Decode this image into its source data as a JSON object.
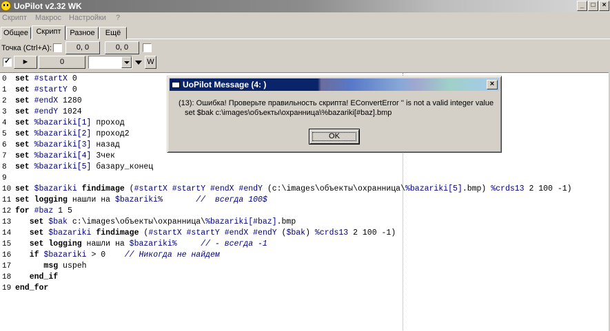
{
  "window": {
    "title": "UoPilot  v2.32   WK",
    "minimize": "_",
    "maximize": "□",
    "close": "×"
  },
  "menu": [
    "Скрипт",
    "Макрос",
    "Настройки",
    "?"
  ],
  "tabs": [
    "Общее",
    "Скрипт",
    "Разное",
    "Ещё"
  ],
  "toolbar": {
    "point_label": "Точка (Ctrl+A):",
    "coord1": "0, 0",
    "coord2": "0, 0",
    "play": "►",
    "counter": "0",
    "combo_value": "",
    "w_button": "W"
  },
  "editor": {
    "lines": [
      {
        "n": "0",
        "parts": [
          [
            "kw",
            "set"
          ],
          [
            "txt",
            " "
          ],
          [
            "var",
            "#startX"
          ],
          [
            "txt",
            " 0"
          ]
        ]
      },
      {
        "n": "1",
        "parts": [
          [
            "kw",
            "set"
          ],
          [
            "txt",
            " "
          ],
          [
            "var",
            "#startY"
          ],
          [
            "txt",
            " 0"
          ]
        ]
      },
      {
        "n": "2",
        "parts": [
          [
            "kw",
            "set"
          ],
          [
            "txt",
            " "
          ],
          [
            "var",
            "#endX"
          ],
          [
            "txt",
            " 1280"
          ]
        ]
      },
      {
        "n": "3",
        "parts": [
          [
            "kw",
            "set"
          ],
          [
            "txt",
            " "
          ],
          [
            "var",
            "#endY"
          ],
          [
            "txt",
            " 1024"
          ]
        ]
      },
      {
        "n": "4",
        "parts": [
          [
            "kw",
            "set"
          ],
          [
            "txt",
            " "
          ],
          [
            "var",
            "%bazariki[1]"
          ],
          [
            "txt",
            " проход"
          ]
        ]
      },
      {
        "n": "5",
        "parts": [
          [
            "kw",
            "set"
          ],
          [
            "txt",
            " "
          ],
          [
            "var",
            "%bazariki[2]"
          ],
          [
            "txt",
            " проход2"
          ]
        ]
      },
      {
        "n": "6",
        "parts": [
          [
            "kw",
            "set"
          ],
          [
            "txt",
            " "
          ],
          [
            "var",
            "%bazariki[3]"
          ],
          [
            "txt",
            " назад"
          ]
        ]
      },
      {
        "n": "7",
        "parts": [
          [
            "kw",
            "set"
          ],
          [
            "txt",
            " "
          ],
          [
            "var",
            "%bazariki[4]"
          ],
          [
            "txt",
            " 3чек"
          ]
        ]
      },
      {
        "n": "8",
        "parts": [
          [
            "kw",
            "set"
          ],
          [
            "txt",
            " "
          ],
          [
            "var",
            "%bazariki[5]"
          ],
          [
            "txt",
            " базару_конец"
          ]
        ]
      },
      {
        "n": "9",
        "parts": []
      },
      {
        "n": "10",
        "parts": [
          [
            "kw",
            "set"
          ],
          [
            "txt",
            " "
          ],
          [
            "var",
            "$bazariki"
          ],
          [
            "txt",
            " "
          ],
          [
            "kw",
            "findimage"
          ],
          [
            "txt",
            " ("
          ],
          [
            "var",
            "#startX #startY #endX #endY"
          ],
          [
            "txt",
            " (c:\\images\\объекты\\охранница\\"
          ],
          [
            "var",
            "%bazariki[5]"
          ],
          [
            "txt",
            ".bmp) "
          ],
          [
            "var",
            "%crds13"
          ],
          [
            "txt",
            " 2 100 -1)"
          ]
        ]
      },
      {
        "n": "11",
        "parts": [
          [
            "kw",
            "set"
          ],
          [
            "txt",
            " "
          ],
          [
            "kw",
            "logging"
          ],
          [
            "txt",
            " нашли на "
          ],
          [
            "var",
            "$bazariki%"
          ],
          [
            "txt",
            "       "
          ],
          [
            "cmt",
            "//  всегда 100$"
          ]
        ]
      },
      {
        "n": "12",
        "parts": [
          [
            "kw",
            "for"
          ],
          [
            "txt",
            " "
          ],
          [
            "var",
            "#baz"
          ],
          [
            "txt",
            " 1 5"
          ]
        ]
      },
      {
        "n": "13",
        "parts": [
          [
            "txt",
            "   "
          ],
          [
            "kw",
            "set"
          ],
          [
            "txt",
            " "
          ],
          [
            "var",
            "$bak"
          ],
          [
            "txt",
            " c:\\images\\объекты\\охранница\\"
          ],
          [
            "var",
            "%bazariki[#baz]"
          ],
          [
            "txt",
            ".bmp"
          ]
        ]
      },
      {
        "n": "14",
        "parts": [
          [
            "txt",
            "   "
          ],
          [
            "kw",
            "set"
          ],
          [
            "txt",
            " "
          ],
          [
            "var",
            "$bazariki"
          ],
          [
            "txt",
            " "
          ],
          [
            "kw",
            "findimage"
          ],
          [
            "txt",
            " ("
          ],
          [
            "var",
            "#startX #startY #endX #endY"
          ],
          [
            "txt",
            " ("
          ],
          [
            "var",
            "$bak"
          ],
          [
            "txt",
            ") "
          ],
          [
            "var",
            "%crds13"
          ],
          [
            "txt",
            " 2 100 -1)"
          ]
        ]
      },
      {
        "n": "15",
        "parts": [
          [
            "txt",
            "   "
          ],
          [
            "kw",
            "set"
          ],
          [
            "txt",
            " "
          ],
          [
            "kw",
            "logging"
          ],
          [
            "txt",
            " нашли на "
          ],
          [
            "var",
            "$bazariki%"
          ],
          [
            "txt",
            "     "
          ],
          [
            "cmt",
            "// - всегда -1"
          ]
        ]
      },
      {
        "n": "16",
        "parts": [
          [
            "txt",
            "   "
          ],
          [
            "kw",
            "if"
          ],
          [
            "txt",
            " "
          ],
          [
            "var",
            "$bazariki"
          ],
          [
            "txt",
            " > 0    "
          ],
          [
            "cmt",
            "// Никогда не найдем"
          ]
        ]
      },
      {
        "n": "17",
        "parts": [
          [
            "txt",
            "      "
          ],
          [
            "kw",
            "msg"
          ],
          [
            "txt",
            " uspeh"
          ]
        ]
      },
      {
        "n": "18",
        "parts": [
          [
            "txt",
            "   "
          ],
          [
            "kw",
            "end_if"
          ]
        ]
      },
      {
        "n": "19",
        "parts": [
          [
            "kw",
            "end_for"
          ]
        ]
      }
    ]
  },
  "dialog": {
    "title": "UoPilot Message  (4: )",
    "close": "×",
    "line1": "(13): Ошибка! Проверьте правильность скрипта! EConvertError '' is not a valid integer value",
    "line2": "set $bak c:\\images\\объекты\\охранница\\%bazariki[#baz].bmp",
    "ok": "OK"
  }
}
